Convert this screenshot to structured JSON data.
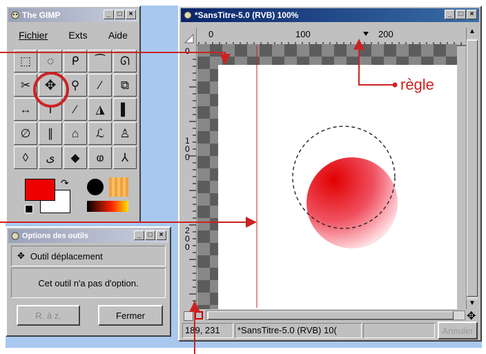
{
  "toolbox": {
    "title": "The GIMP",
    "menus": [
      "Fichier",
      "Exts",
      "Aide"
    ],
    "tools": [
      "rect-select",
      "ellipse-select",
      "free-select",
      "fuzzy-select",
      "bezier-select",
      "scissors",
      "move",
      "magnify",
      "crop",
      "transform",
      "flip",
      "text",
      "color-picker",
      "bucket-fill",
      "gradient",
      "pencil",
      "paintbrush",
      "eraser",
      "airbrush",
      "clone",
      "blur",
      "ink",
      "dodge",
      "smudge",
      "measure"
    ],
    "tool_glyphs": [
      "⬚",
      "◌",
      "ᑭ",
      "⁀",
      "ᘏ",
      "✂",
      "✥",
      "⚲",
      "∕",
      "⧉",
      "↔",
      "T",
      "⁄",
      "◮",
      "▌",
      "∅",
      "∥",
      "⌂",
      "ℒ",
      "♙",
      "◊",
      "ﻯ",
      "◆",
      "ⱷ",
      "⅄"
    ],
    "fg_color": "#ee0000",
    "bg_color": "#ffffff"
  },
  "options": {
    "title": "Options des outils",
    "tool_name": "Outil déplacement",
    "message": "Cet outil n'a pas d'option.",
    "reset_label": "R. à z.",
    "close_label": "Fermer"
  },
  "image": {
    "title": "*SansTitre-5.0 (RVB) 100%",
    "ruler_top_labels": [
      "0",
      "100",
      "200"
    ],
    "ruler_left_labels": [
      "0",
      "1\n0\n0",
      "2\n0\n0"
    ],
    "coords": "189, 231",
    "status_text": "*SansTitre-5.0 (RVB) 10(",
    "cancel_label": "Annuler"
  },
  "annotations": {
    "ruler_label": "règle"
  },
  "colors": {
    "annotation": "#cc2222",
    "window_bg": "#c0c0c0",
    "active_title": "#0a246a",
    "desktop": "#a8c8f0"
  }
}
